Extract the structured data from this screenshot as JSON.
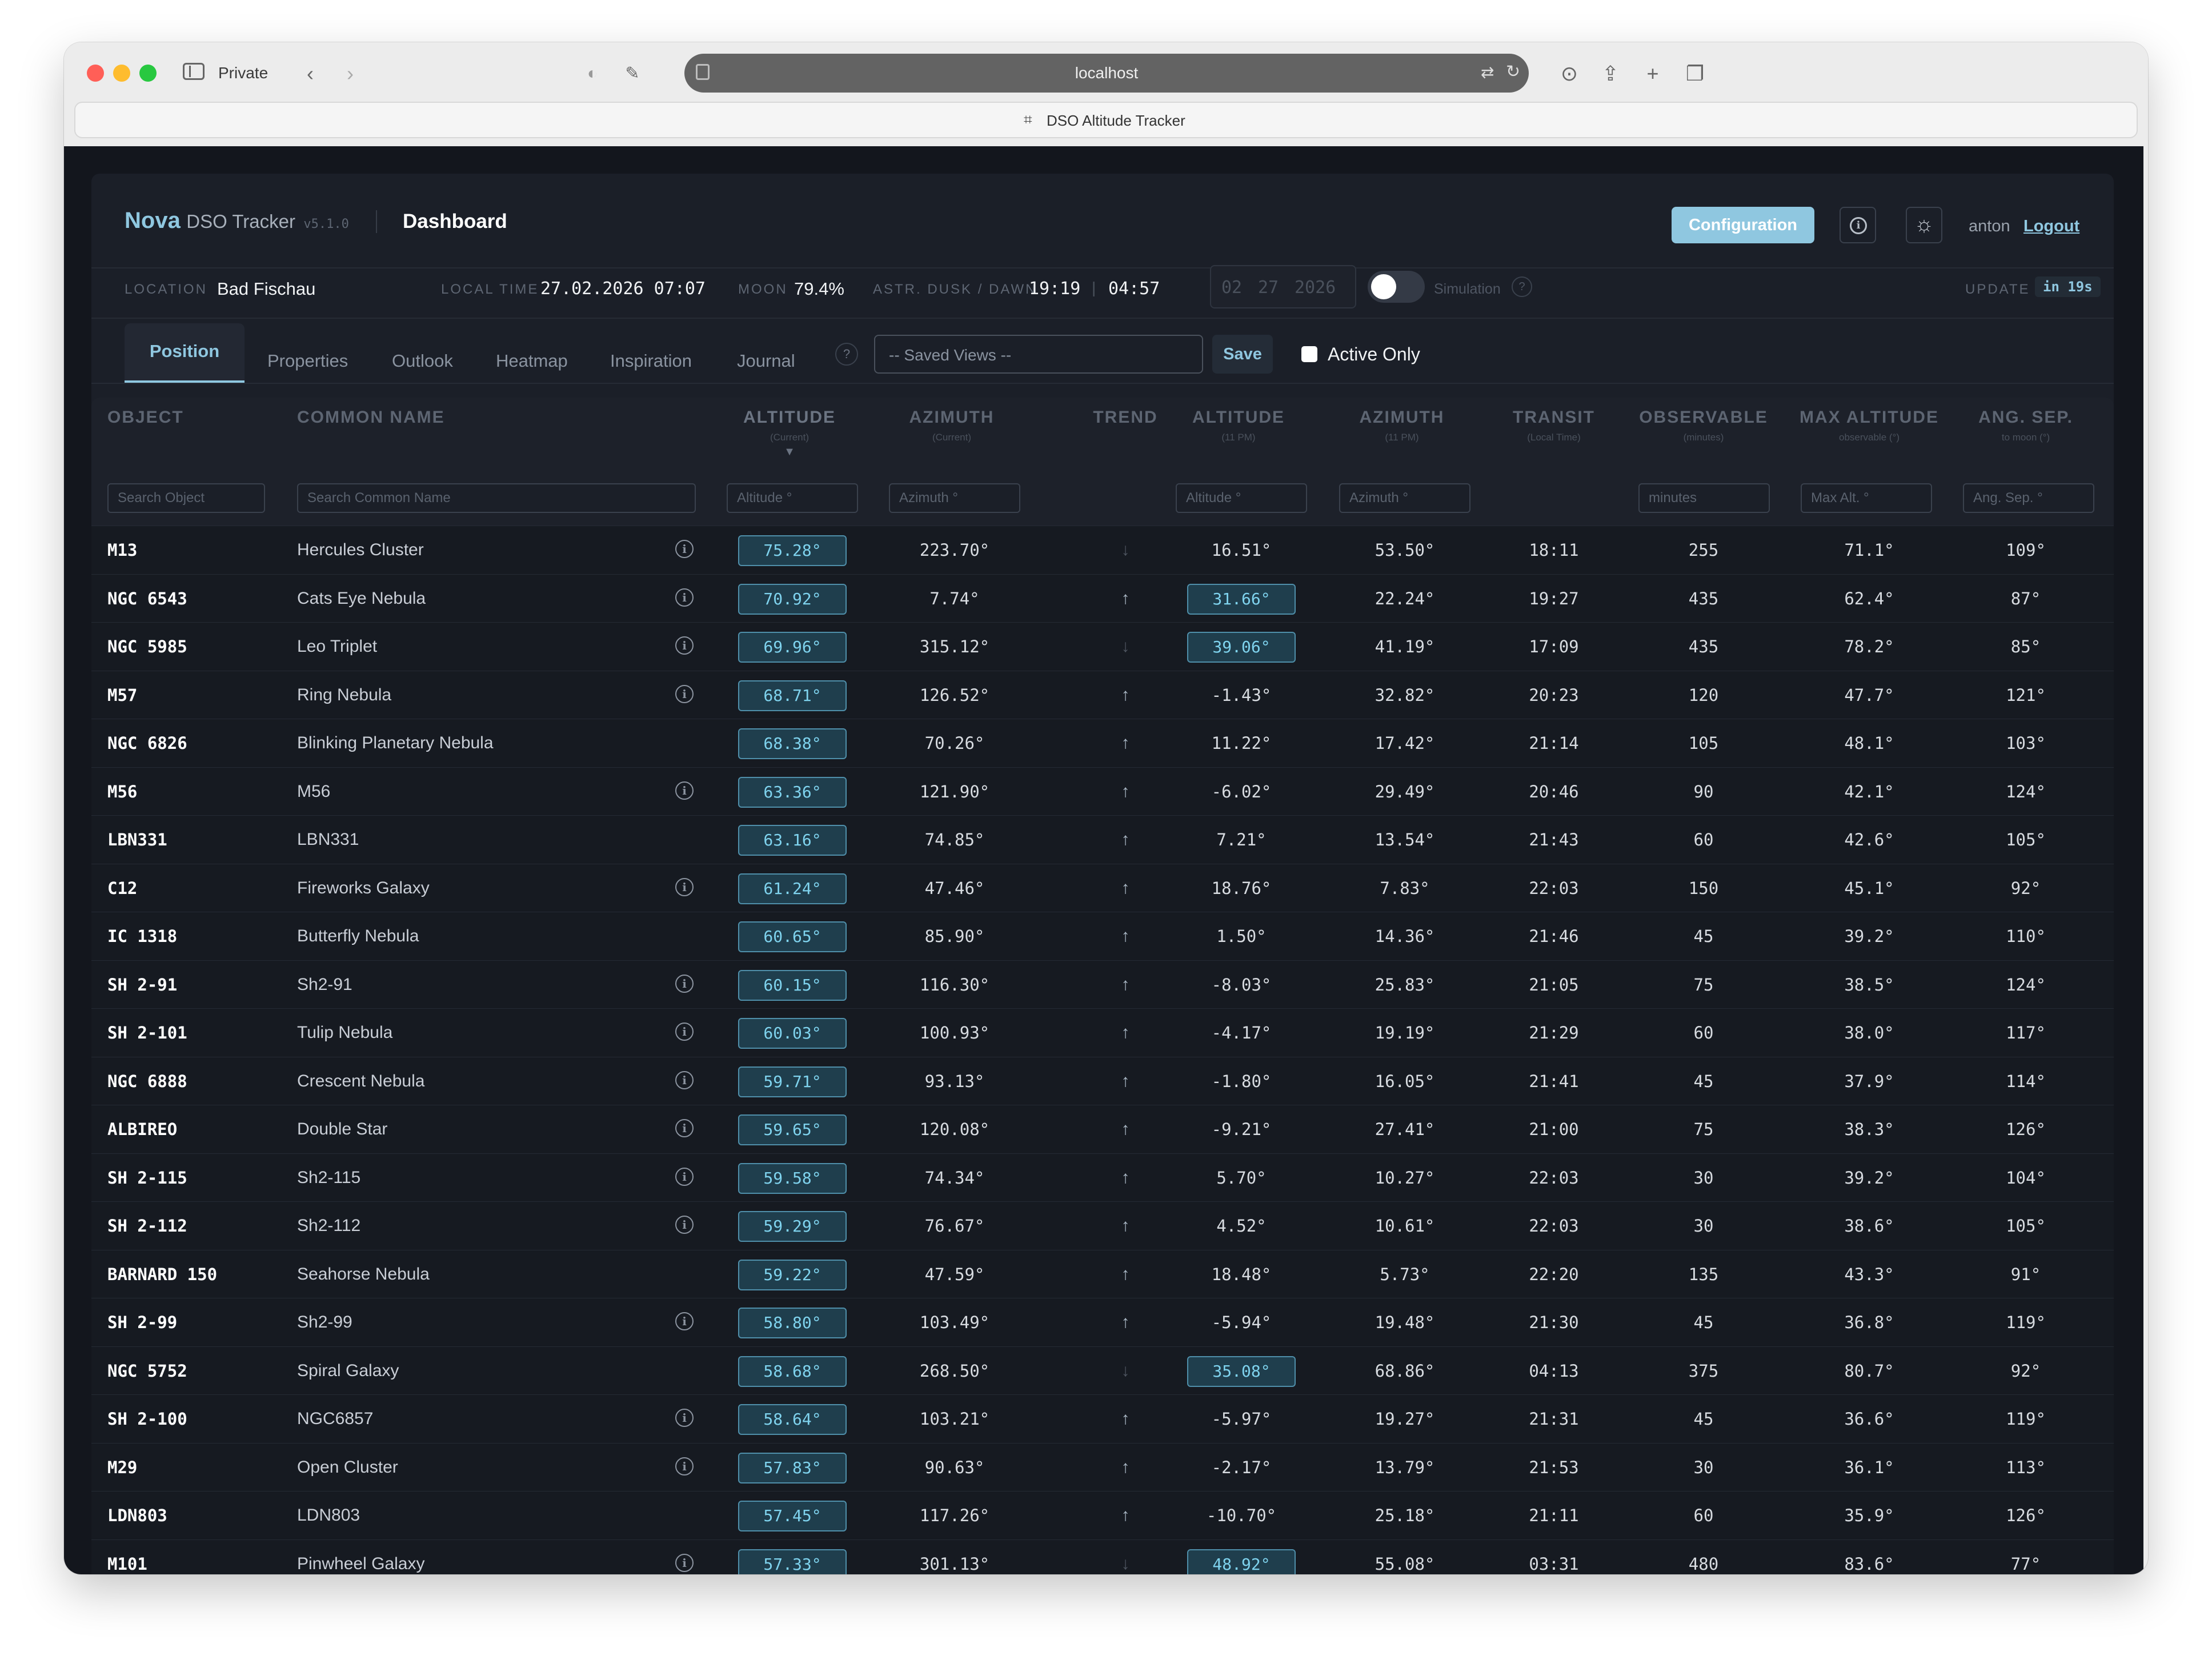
{
  "browser": {
    "private_label": "Private",
    "url": "localhost",
    "tab_title": "DSO Altitude Tracker"
  },
  "header": {
    "brand": "Nova",
    "product": "DSO Tracker",
    "version": "v5.1.0",
    "page_title": "Dashboard",
    "config_button": "Configuration",
    "user": "anton",
    "logout": "Logout"
  },
  "status": {
    "location_label": "LOCATION",
    "location": "Bad Fischau",
    "local_time_label": "LOCAL TIME",
    "local_time": "27.02.2026 07:07",
    "moon_label": "MOON",
    "moon": "79.4%",
    "dusk_label": "ASTR. DUSK / DAWN",
    "dusk": "19:19",
    "separator": "|",
    "dawn": "04:57",
    "date_month": "02",
    "date_day": "27",
    "date_year": "2026",
    "simulation_label": "Simulation",
    "simulation_on": false,
    "update_label": "UPDATE",
    "update": "in 19s"
  },
  "tabs": [
    "Position",
    "Properties",
    "Outlook",
    "Heatmap",
    "Inspiration",
    "Journal"
  ],
  "active_tab": "Position",
  "help": "?",
  "saved_views_placeholder": "-- Saved Views --",
  "save_button": "Save",
  "active_only_label": "Active Only",
  "active_only_checked": false,
  "columns": {
    "object": "OBJECT",
    "common_name": "COMMON NAME",
    "altitude": "ALTITUDE",
    "altitude_sub": "(Current)",
    "azimuth": "AZIMUTH",
    "azimuth_sub": "(Current)",
    "trend": "TREND",
    "altitude11": "ALTITUDE",
    "altitude11_sub": "(11 PM)",
    "azimuth11": "AZIMUTH",
    "azimuth11_sub": "(11 PM)",
    "transit": "TRANSIT",
    "transit_sub": "(Local Time)",
    "observable": "OBSERVABLE",
    "observable_sub": "(minutes)",
    "max_altitude": "MAX ALTITUDE",
    "max_altitude_sub": "observable (°)",
    "ang_sep": "ANG. SEP.",
    "ang_sep_sub": "to moon (°)",
    "sort_indicator": "▼"
  },
  "filters": {
    "object": "Search Object",
    "common_name": "Search Common Name",
    "altitude": "Altitude °",
    "azimuth": "Azimuth °",
    "altitude11": "Altitude °",
    "azimuth11": "Azimuth °",
    "observable": "minutes",
    "max_altitude": "Max Alt. °",
    "ang_sep": "Ang. Sep. °"
  },
  "rows": [
    {
      "object": "M13",
      "name": "Hercules Cluster",
      "info": true,
      "alt": "75.28°",
      "az": "223.70°",
      "trend": "down",
      "alt11": "16.51°",
      "alt11_hl": false,
      "az11": "53.50°",
      "transit": "18:11",
      "obs": "255",
      "max": "71.1°",
      "sep": "109°"
    },
    {
      "object": "NGC 6543",
      "name": "Cats Eye Nebula",
      "info": true,
      "alt": "70.92°",
      "az": "7.74°",
      "trend": "up",
      "alt11": "31.66°",
      "alt11_hl": true,
      "az11": "22.24°",
      "transit": "19:27",
      "obs": "435",
      "max": "62.4°",
      "sep": "87°"
    },
    {
      "object": "NGC 5985",
      "name": "Leo Triplet",
      "info": true,
      "alt": "69.96°",
      "az": "315.12°",
      "trend": "down",
      "alt11": "39.06°",
      "alt11_hl": true,
      "az11": "41.19°",
      "transit": "17:09",
      "obs": "435",
      "max": "78.2°",
      "sep": "85°"
    },
    {
      "object": "M57",
      "name": "Ring Nebula",
      "info": true,
      "alt": "68.71°",
      "az": "126.52°",
      "trend": "up",
      "alt11": "-1.43°",
      "alt11_hl": false,
      "az11": "32.82°",
      "transit": "20:23",
      "obs": "120",
      "max": "47.7°",
      "sep": "121°"
    },
    {
      "object": "NGC 6826",
      "name": "Blinking Planetary Nebula",
      "info": false,
      "alt": "68.38°",
      "az": "70.26°",
      "trend": "up",
      "alt11": "11.22°",
      "alt11_hl": false,
      "az11": "17.42°",
      "transit": "21:14",
      "obs": "105",
      "max": "48.1°",
      "sep": "103°"
    },
    {
      "object": "M56",
      "name": "M56",
      "info": true,
      "alt": "63.36°",
      "az": "121.90°",
      "trend": "up",
      "alt11": "-6.02°",
      "alt11_hl": false,
      "az11": "29.49°",
      "transit": "20:46",
      "obs": "90",
      "max": "42.1°",
      "sep": "124°"
    },
    {
      "object": "LBN331",
      "name": "LBN331",
      "info": false,
      "alt": "63.16°",
      "az": "74.85°",
      "trend": "up",
      "alt11": "7.21°",
      "alt11_hl": false,
      "az11": "13.54°",
      "transit": "21:43",
      "obs": "60",
      "max": "42.6°",
      "sep": "105°"
    },
    {
      "object": "C12",
      "name": "Fireworks Galaxy",
      "info": true,
      "alt": "61.24°",
      "az": "47.46°",
      "trend": "up",
      "alt11": "18.76°",
      "alt11_hl": false,
      "az11": "7.83°",
      "transit": "22:03",
      "obs": "150",
      "max": "45.1°",
      "sep": "92°"
    },
    {
      "object": "IC 1318",
      "name": "Butterfly Nebula",
      "info": false,
      "alt": "60.65°",
      "az": "85.90°",
      "trend": "up",
      "alt11": "1.50°",
      "alt11_hl": false,
      "az11": "14.36°",
      "transit": "21:46",
      "obs": "45",
      "max": "39.2°",
      "sep": "110°"
    },
    {
      "object": "SH 2-91",
      "name": "Sh2-91",
      "info": true,
      "alt": "60.15°",
      "az": "116.30°",
      "trend": "up",
      "alt11": "-8.03°",
      "alt11_hl": false,
      "az11": "25.83°",
      "transit": "21:05",
      "obs": "75",
      "max": "38.5°",
      "sep": "124°"
    },
    {
      "object": "SH 2-101",
      "name": "Tulip Nebula",
      "info": true,
      "alt": "60.03°",
      "az": "100.93°",
      "trend": "up",
      "alt11": "-4.17°",
      "alt11_hl": false,
      "az11": "19.19°",
      "transit": "21:29",
      "obs": "60",
      "max": "38.0°",
      "sep": "117°"
    },
    {
      "object": "NGC 6888",
      "name": "Crescent Nebula",
      "info": true,
      "alt": "59.71°",
      "az": "93.13°",
      "trend": "up",
      "alt11": "-1.80°",
      "alt11_hl": false,
      "az11": "16.05°",
      "transit": "21:41",
      "obs": "45",
      "max": "37.9°",
      "sep": "114°"
    },
    {
      "object": "ALBIREO",
      "name": "Double Star",
      "info": true,
      "alt": "59.65°",
      "az": "120.08°",
      "trend": "up",
      "alt11": "-9.21°",
      "alt11_hl": false,
      "az11": "27.41°",
      "transit": "21:00",
      "obs": "75",
      "max": "38.3°",
      "sep": "126°"
    },
    {
      "object": "SH 2-115",
      "name": "Sh2-115",
      "info": true,
      "alt": "59.58°",
      "az": "74.34°",
      "trend": "up",
      "alt11": "5.70°",
      "alt11_hl": false,
      "az11": "10.27°",
      "transit": "22:03",
      "obs": "30",
      "max": "39.2°",
      "sep": "104°"
    },
    {
      "object": "SH 2-112",
      "name": "Sh2-112",
      "info": true,
      "alt": "59.29°",
      "az": "76.67°",
      "trend": "up",
      "alt11": "4.52°",
      "alt11_hl": false,
      "az11": "10.61°",
      "transit": "22:03",
      "obs": "30",
      "max": "38.6°",
      "sep": "105°"
    },
    {
      "object": "BARNARD 150",
      "name": "Seahorse Nebula",
      "info": false,
      "alt": "59.22°",
      "az": "47.59°",
      "trend": "up",
      "alt11": "18.48°",
      "alt11_hl": false,
      "az11": "5.73°",
      "transit": "22:20",
      "obs": "135",
      "max": "43.3°",
      "sep": "91°"
    },
    {
      "object": "SH 2-99",
      "name": "Sh2-99",
      "info": true,
      "alt": "58.80°",
      "az": "103.49°",
      "trend": "up",
      "alt11": "-5.94°",
      "alt11_hl": false,
      "az11": "19.48°",
      "transit": "21:30",
      "obs": "45",
      "max": "36.8°",
      "sep": "119°"
    },
    {
      "object": "NGC 5752",
      "name": "Spiral Galaxy",
      "info": false,
      "alt": "58.68°",
      "az": "268.50°",
      "trend": "down",
      "alt11": "35.08°",
      "alt11_hl": true,
      "az11": "68.86°",
      "transit": "04:13",
      "obs": "375",
      "max": "80.7°",
      "sep": "92°"
    },
    {
      "object": "SH 2-100",
      "name": "NGC6857",
      "info": true,
      "alt": "58.64°",
      "az": "103.21°",
      "trend": "up",
      "alt11": "-5.97°",
      "alt11_hl": false,
      "az11": "19.27°",
      "transit": "21:31",
      "obs": "45",
      "max": "36.6°",
      "sep": "119°"
    },
    {
      "object": "M29",
      "name": "Open Cluster",
      "info": true,
      "alt": "57.83°",
      "az": "90.63°",
      "trend": "up",
      "alt11": "-2.17°",
      "alt11_hl": false,
      "az11": "13.79°",
      "transit": "21:53",
      "obs": "30",
      "max": "36.1°",
      "sep": "113°"
    },
    {
      "object": "LDN803",
      "name": "LDN803",
      "info": false,
      "alt": "57.45°",
      "az": "117.26°",
      "trend": "up",
      "alt11": "-10.70°",
      "alt11_hl": false,
      "az11": "25.18°",
      "transit": "21:11",
      "obs": "60",
      "max": "35.9°",
      "sep": "126°"
    },
    {
      "object": "M101",
      "name": "Pinwheel Galaxy",
      "info": true,
      "alt": "57.33°",
      "az": "301.13°",
      "trend": "down",
      "alt11": "48.92°",
      "alt11_hl": true,
      "az11": "55.08°",
      "transit": "03:31",
      "obs": "480",
      "max": "83.6°",
      "sep": "77°"
    }
  ],
  "colors": {
    "accent": "#8fc7e0",
    "pill_bg": "#1f3e4d",
    "pill_border": "#4f8faa",
    "pill_text": "#7fd3ee",
    "background": "#1b1f28"
  }
}
